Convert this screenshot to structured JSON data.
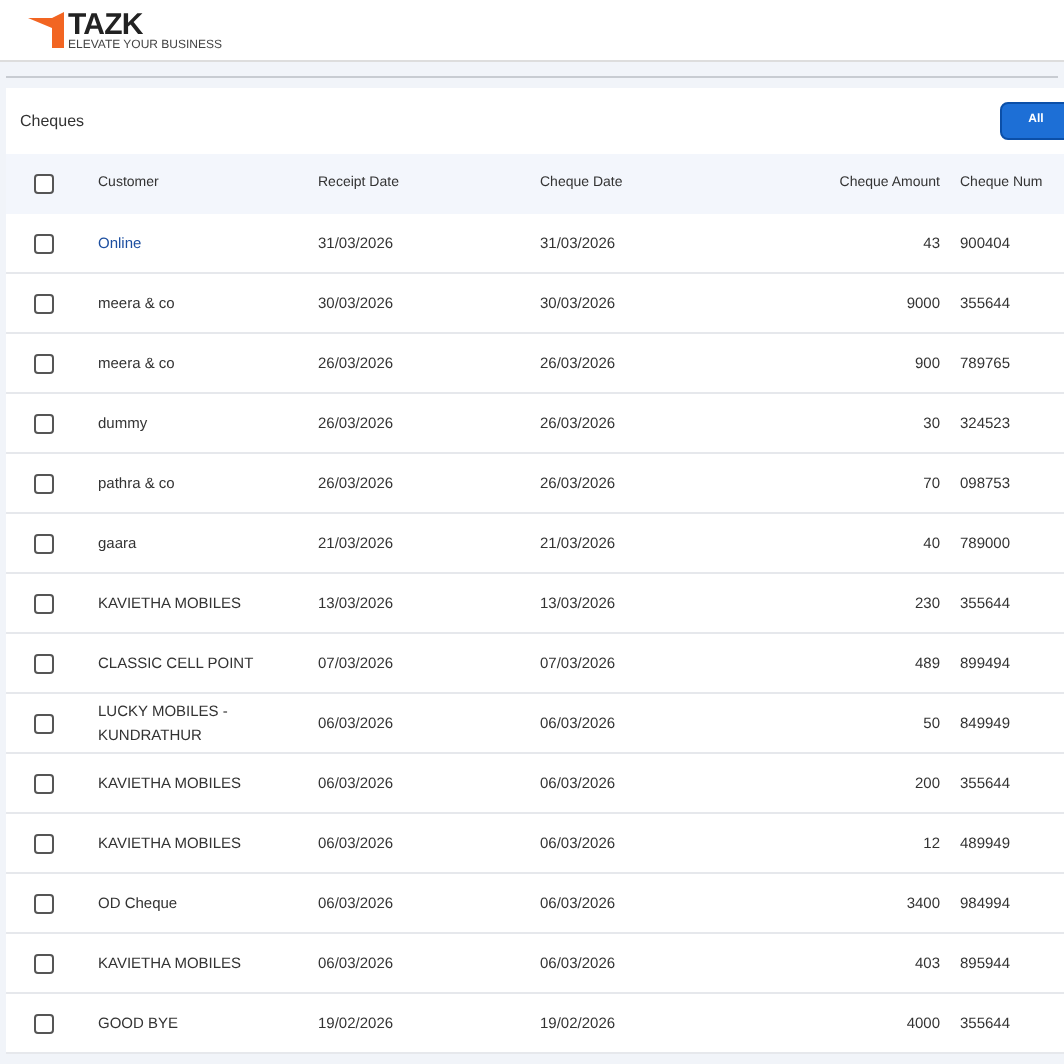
{
  "logo": {
    "name": "TAZK",
    "tagline": "ELEVATE YOUR BUSINESS"
  },
  "panel": {
    "title": "Cheques",
    "filter_button": "All"
  },
  "table": {
    "columns": [
      "Customer",
      "Receipt Date",
      "Cheque Date",
      "Cheque Amount",
      "Cheque Num"
    ],
    "header_checked": false,
    "rows": [
      {
        "checked": false,
        "customer": "Online",
        "receipt_date": "31/03/2026",
        "cheque_date": "31/03/2026",
        "amount": "43",
        "number": "900404"
      },
      {
        "checked": false,
        "customer": "meera & co",
        "receipt_date": "30/03/2026",
        "cheque_date": "30/03/2026",
        "amount": "9000",
        "number": "355644"
      },
      {
        "checked": false,
        "customer": "meera & co",
        "receipt_date": "26/03/2026",
        "cheque_date": "26/03/2026",
        "amount": "900",
        "number": "789765"
      },
      {
        "checked": false,
        "customer": "dummy",
        "receipt_date": "26/03/2026",
        "cheque_date": "26/03/2026",
        "amount": "30",
        "number": "324523"
      },
      {
        "checked": false,
        "customer": "pathra & co",
        "receipt_date": "26/03/2026",
        "cheque_date": "26/03/2026",
        "amount": "70",
        "number": "098753"
      },
      {
        "checked": false,
        "customer": "gaara",
        "receipt_date": "21/03/2026",
        "cheque_date": "21/03/2026",
        "amount": "40",
        "number": "789000"
      },
      {
        "checked": false,
        "customer": "KAVIETHA MOBILES",
        "receipt_date": "13/03/2026",
        "cheque_date": "13/03/2026",
        "amount": "230",
        "number": "355644"
      },
      {
        "checked": false,
        "customer": "CLASSIC CELL POINT",
        "receipt_date": "07/03/2026",
        "cheque_date": "07/03/2026",
        "amount": "489",
        "number": "899494"
      },
      {
        "checked": false,
        "customer": "LUCKY MOBILES - KUNDRATHUR",
        "receipt_date": "06/03/2026",
        "cheque_date": "06/03/2026",
        "amount": "50",
        "number": "849949"
      },
      {
        "checked": false,
        "customer": "KAVIETHA MOBILES",
        "receipt_date": "06/03/2026",
        "cheque_date": "06/03/2026",
        "amount": "200",
        "number": "355644"
      },
      {
        "checked": false,
        "customer": "KAVIETHA MOBILES",
        "receipt_date": "06/03/2026",
        "cheque_date": "06/03/2026",
        "amount": "12",
        "number": "489949"
      },
      {
        "checked": false,
        "customer": "OD Cheque",
        "receipt_date": "06/03/2026",
        "cheque_date": "06/03/2026",
        "amount": "3400",
        "number": "984994"
      },
      {
        "checked": false,
        "customer": "KAVIETHA MOBILES",
        "receipt_date": "06/03/2026",
        "cheque_date": "06/03/2026",
        "amount": "403",
        "number": "895944"
      },
      {
        "checked": false,
        "customer": "GOOD BYE",
        "receipt_date": "19/02/2026",
        "cheque_date": "19/02/2026",
        "amount": "4000",
        "number": "355644"
      }
    ]
  }
}
